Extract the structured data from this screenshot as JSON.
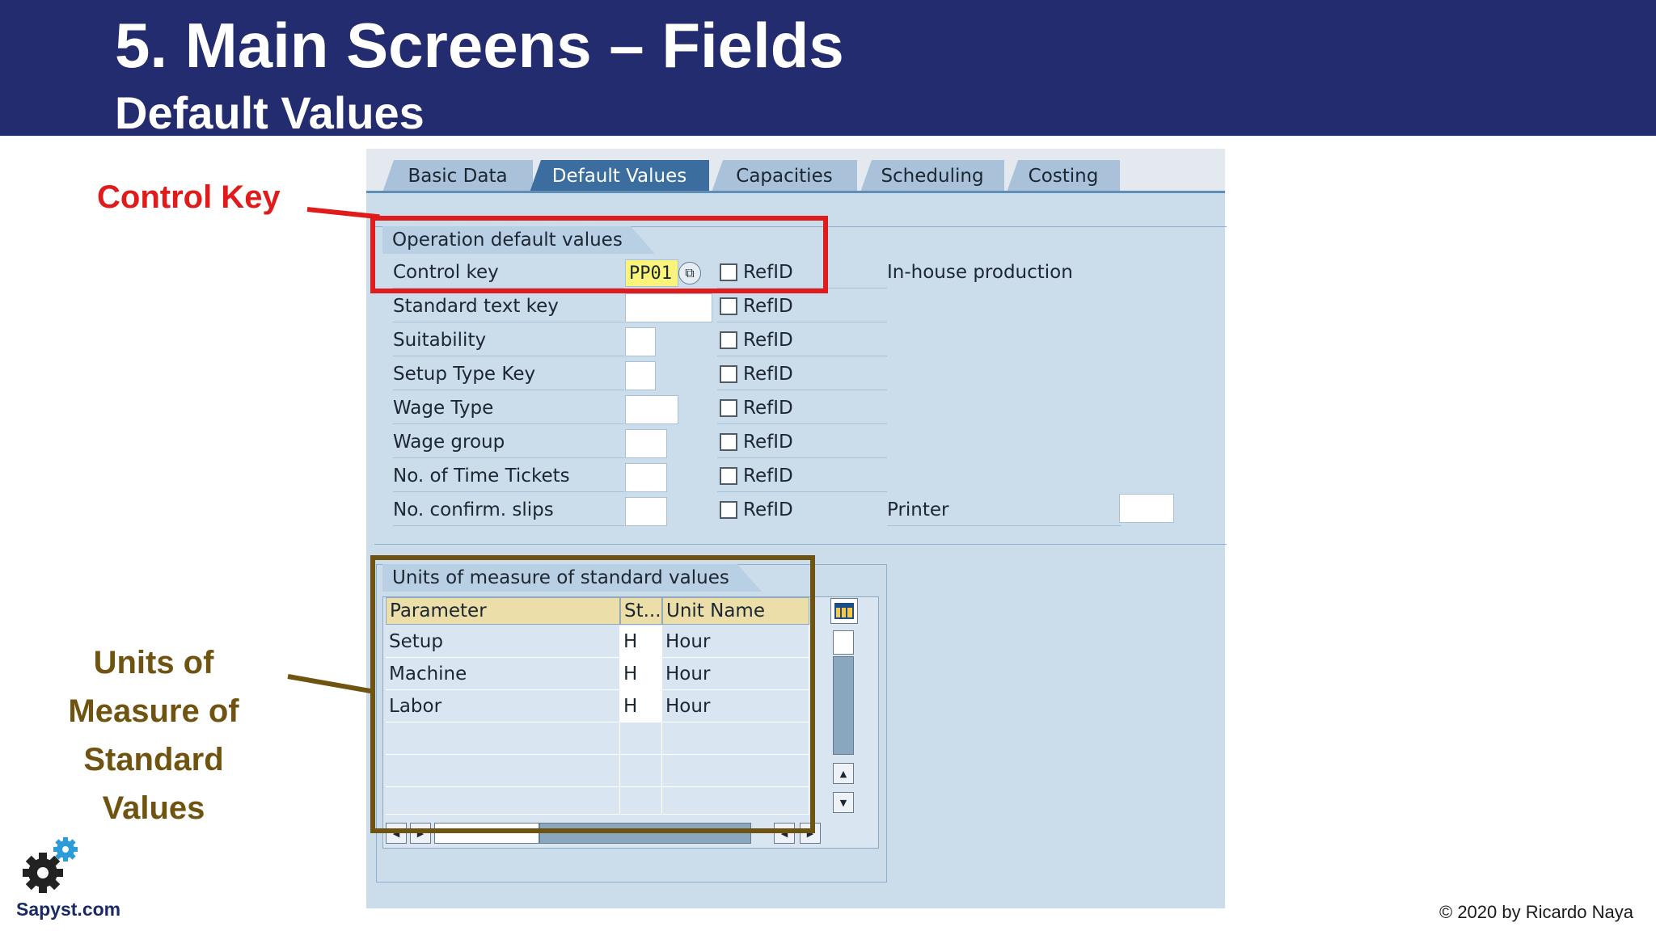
{
  "slide": {
    "title": "5. Main Screens – Fields",
    "subtitle": "Default Values"
  },
  "callouts": {
    "control_key": "Control Key",
    "units_lines": [
      "Units of",
      "Measure of",
      "Standard",
      "Values"
    ]
  },
  "tabs": [
    {
      "label": "Basic Data",
      "active": false
    },
    {
      "label": "Default Values",
      "active": true
    },
    {
      "label": "Capacities",
      "active": false
    },
    {
      "label": "Scheduling",
      "active": false
    },
    {
      "label": "Costing",
      "active": false
    }
  ],
  "operation_defaults": {
    "group_title": "Operation default values",
    "refid_label": "RefID",
    "control_key_value": "PP01",
    "control_key_description": "In-house production",
    "rows": [
      {
        "label": "Control key",
        "value": "PP01"
      },
      {
        "label": "Standard text key",
        "value": ""
      },
      {
        "label": "Suitability",
        "value": ""
      },
      {
        "label": "Setup Type Key",
        "value": ""
      },
      {
        "label": "Wage Type",
        "value": ""
      },
      {
        "label": "Wage group",
        "value": ""
      },
      {
        "label": "No. of Time Tickets",
        "value": ""
      },
      {
        "label": "No. confirm. slips",
        "value": ""
      }
    ],
    "printer_label": "Printer",
    "printer_value": ""
  },
  "units_of_measure": {
    "group_title": "Units of measure of standard values",
    "columns": [
      "Parameter",
      "St...",
      "Unit Name"
    ],
    "rows": [
      {
        "parameter": "Setup",
        "unit": "H",
        "unit_name": "Hour"
      },
      {
        "parameter": "Machine",
        "unit": "H",
        "unit_name": "Hour"
      },
      {
        "parameter": "Labor",
        "unit": "H",
        "unit_name": "Hour"
      }
    ]
  },
  "footer": {
    "brand": "Sapyst.com",
    "copyright": "© 2020 by Ricardo Naya"
  },
  "colors": {
    "header_bg": "#232c6e",
    "sap_bg": "#cbdcea",
    "active_tab": "#3b6e9e",
    "highlight_red": "#e01b1b",
    "highlight_brown": "#6e5410",
    "control_key_field": "#fbf47a"
  }
}
